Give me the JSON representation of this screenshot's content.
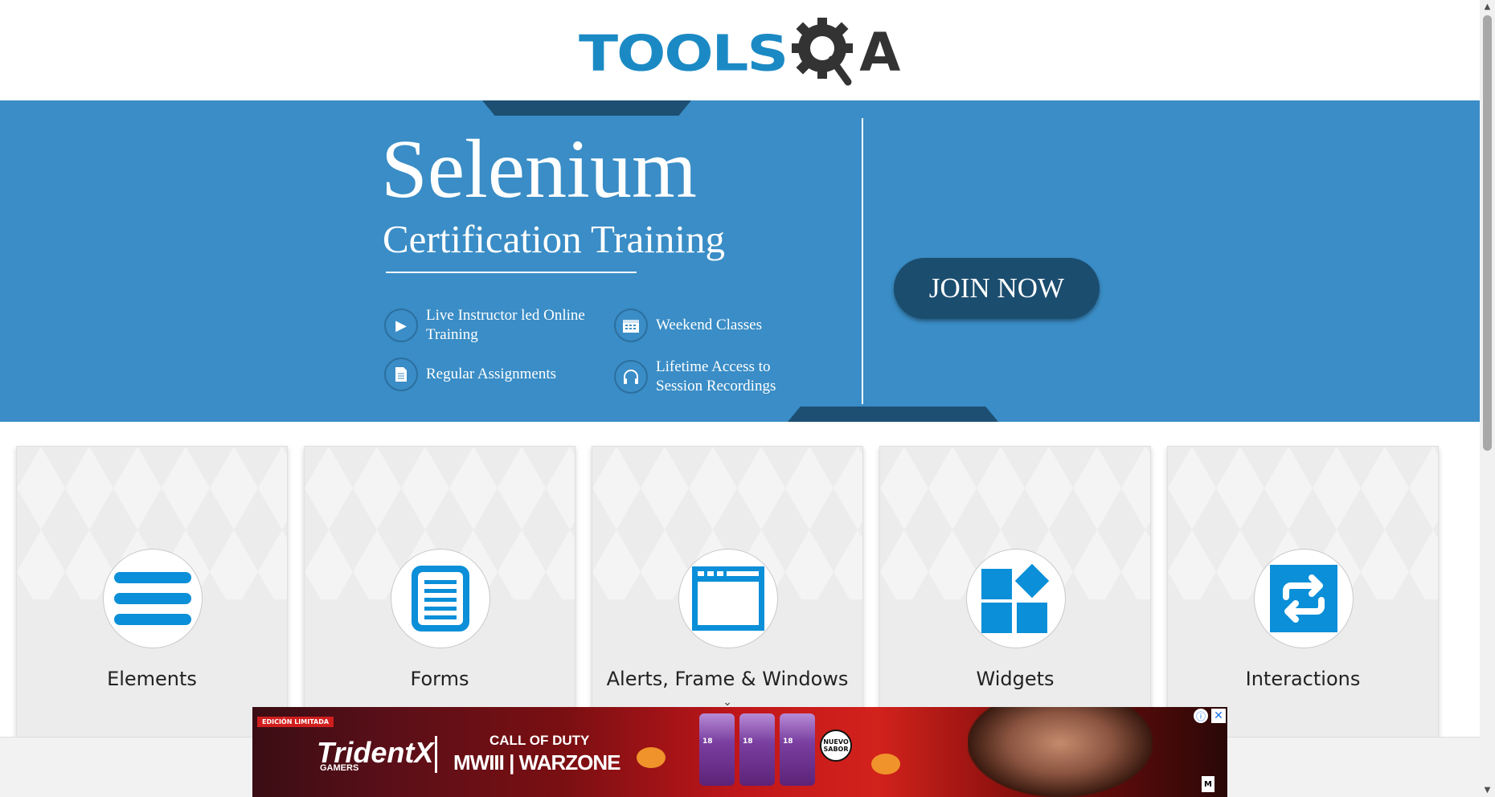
{
  "header": {
    "logo_text": "TOOLS",
    "logo_suffix": "A"
  },
  "banner": {
    "title": "Selenium",
    "subtitle": "Certification Training",
    "features": [
      {
        "icon": "play-icon",
        "text": "Live Instructor led Online Training"
      },
      {
        "icon": "calendar-icon",
        "text": "Weekend Classes"
      },
      {
        "icon": "document-icon",
        "text": "Regular Assignments"
      },
      {
        "icon": "headphones-icon",
        "text": "Lifetime Access to Session Recordings"
      }
    ],
    "cta_label": "JOIN NOW",
    "colors": {
      "background": "#3a8dc6",
      "accent_dark": "#1b4d6f"
    }
  },
  "cards": [
    {
      "label": "Elements",
      "icon": "hamburger-menu-icon"
    },
    {
      "label": "Forms",
      "icon": "form-document-icon"
    },
    {
      "label": "Alerts, Frame & Windows",
      "icon": "browser-window-icon"
    },
    {
      "label": "Widgets",
      "icon": "widgets-grid-icon"
    },
    {
      "label": "Interactions",
      "icon": "repeat-arrows-icon"
    }
  ],
  "icon_color": "#0a8fd8",
  "ad": {
    "badge": "EDICIÓN LIMITADA",
    "brand": "TridentX",
    "brand_sub": "GAMERS",
    "game_line1": "CALL OF DUTY",
    "game_line2": "MWIII | WARZONE",
    "new_flavor": "NUEVO SABOR",
    "product_label": "18",
    "info_glyph": "ⓘ",
    "close_glyph": "✕",
    "rating": "M"
  }
}
